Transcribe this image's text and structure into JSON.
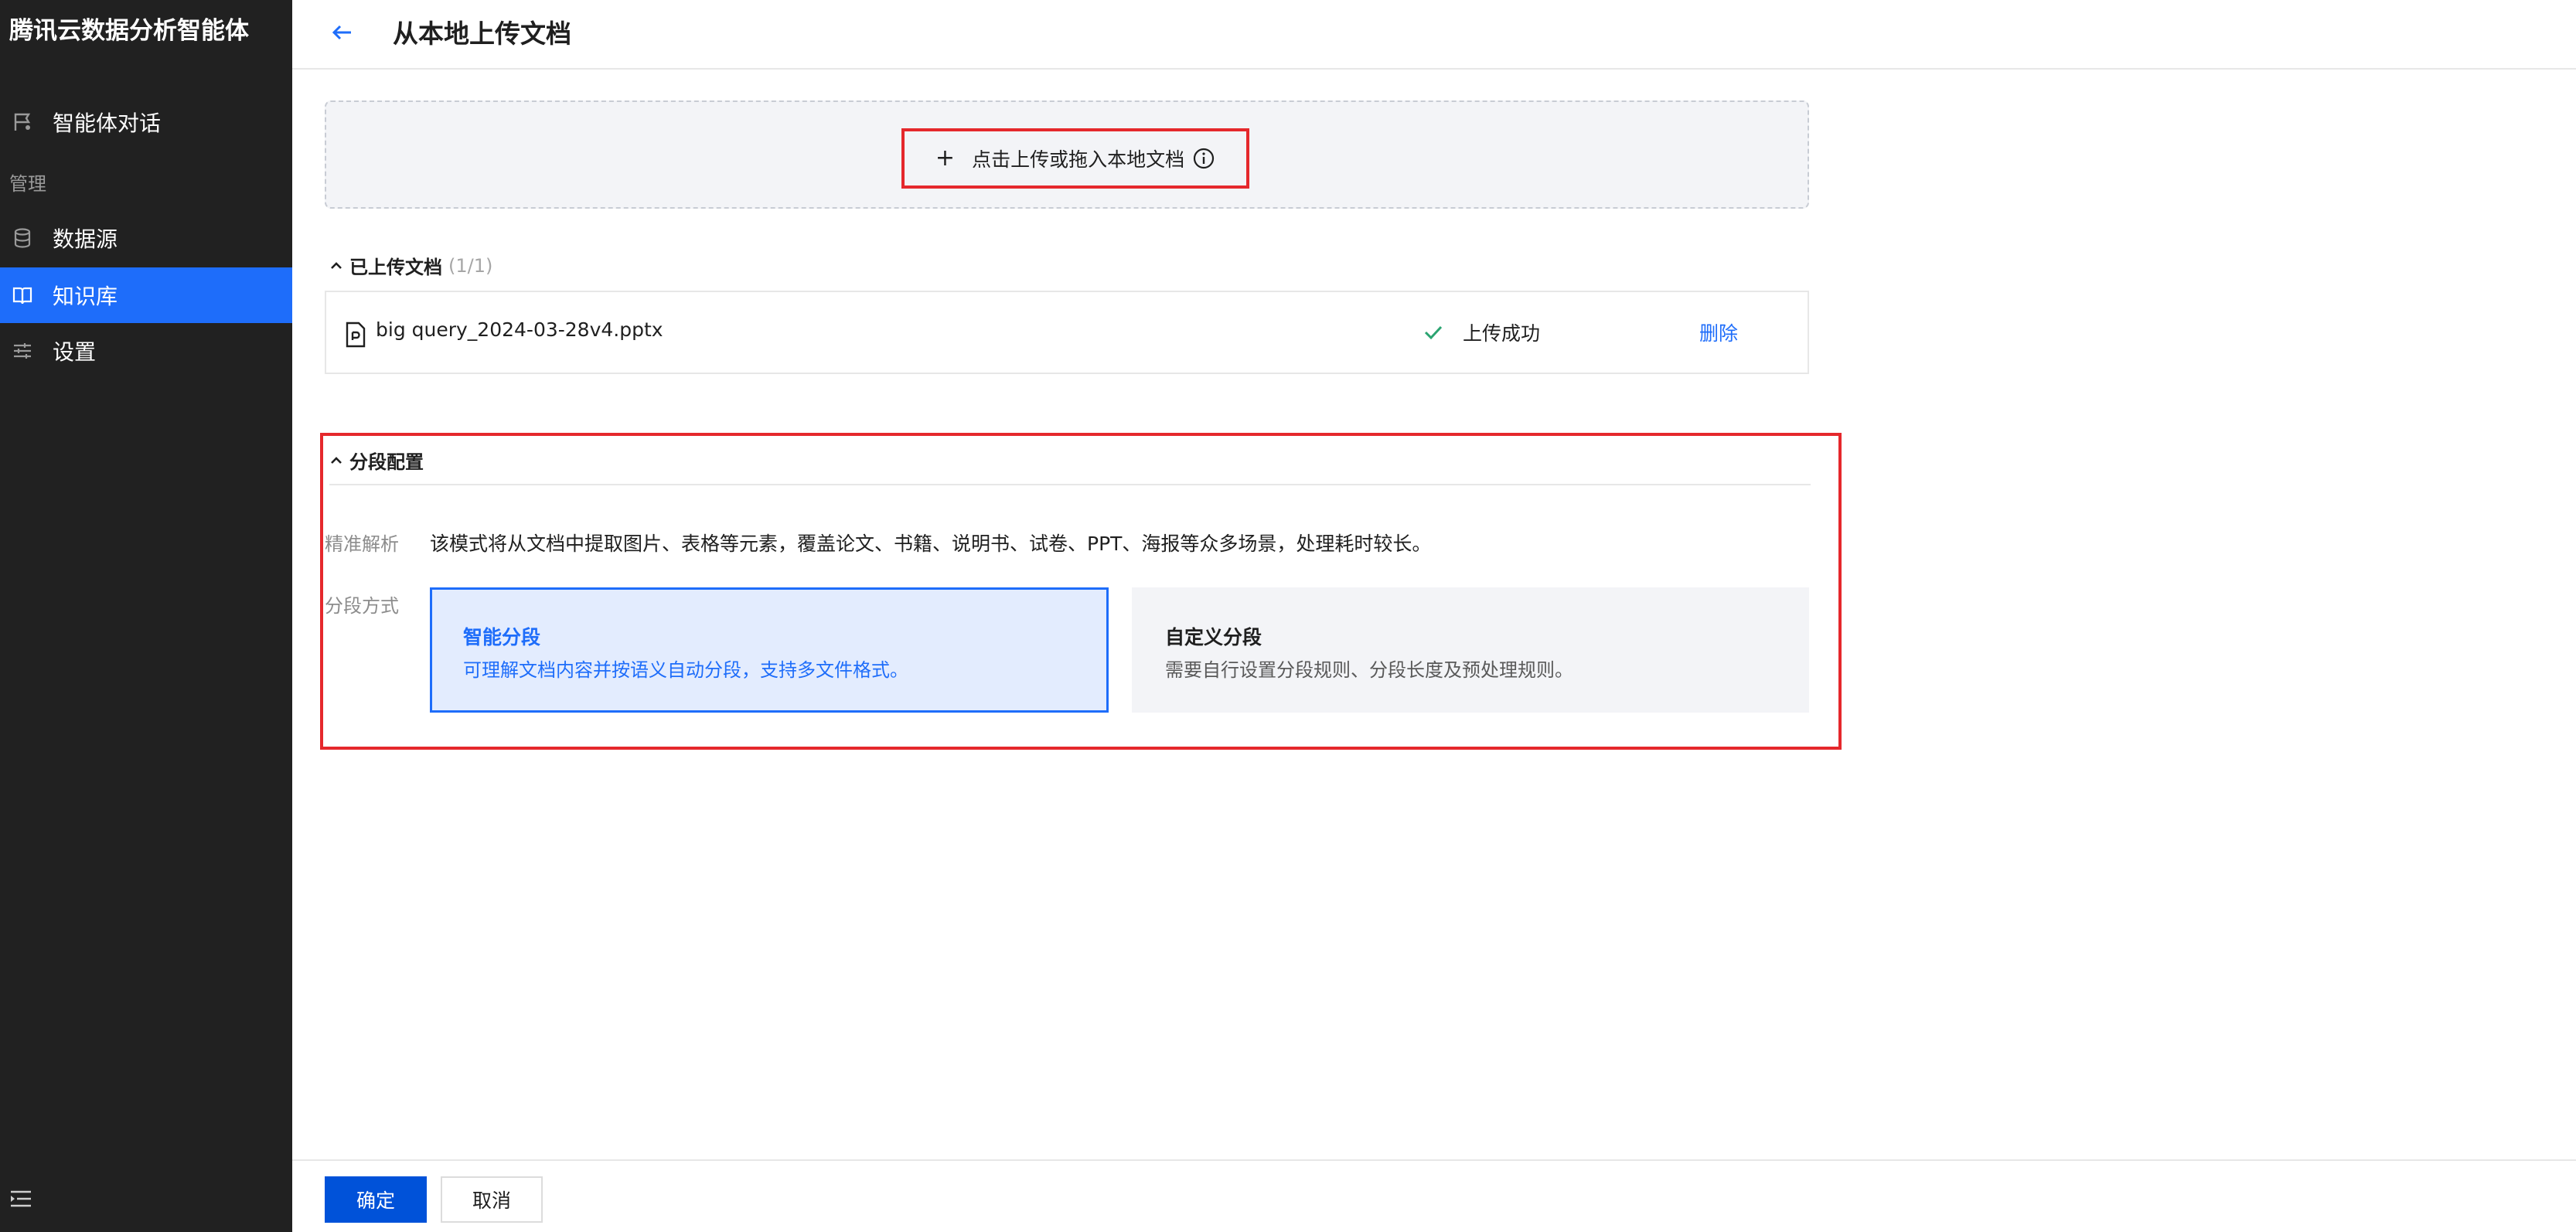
{
  "sidebar": {
    "brand": "腾讯云数据分析智能体",
    "chat_item": {
      "label": "智能体对话",
      "icon": "chat-flag-icon"
    },
    "group_label": "管理",
    "items": [
      {
        "label": "数据源",
        "icon": "database-icon"
      },
      {
        "label": "知识库",
        "icon": "book-icon",
        "active": true
      },
      {
        "label": "设置",
        "icon": "sliders-icon"
      }
    ],
    "collapse_icon": "menu-collapse-icon"
  },
  "header": {
    "back_icon": "arrow-left-icon",
    "title": "从本地上传文档"
  },
  "upload": {
    "plus": "+",
    "label": "点击上传或拖入本地文档",
    "info_icon": "info-circle-icon"
  },
  "uploaded": {
    "title": "已上传文档",
    "count": "(1/1)",
    "files": [
      {
        "name": "big query_2024-03-28v4.pptx",
        "status": "上传成功",
        "delete_label": "删除"
      }
    ]
  },
  "config": {
    "title": "分段配置",
    "parse_label": "精准解析",
    "parse_text": "该模式将从文档中提取图片、表格等元素，覆盖论文、书籍、说明书、试卷、PPT、海报等众多场景，处理耗时较长。",
    "method_label": "分段方式",
    "options": [
      {
        "title": "智能分段",
        "desc": "可理解文档内容并按语义自动分段，支持多文件格式。",
        "selected": true
      },
      {
        "title": "自定义分段",
        "desc": "需要自行设置分段规则、分段长度及预处理规则。",
        "selected": false
      }
    ]
  },
  "footer": {
    "confirm_label": "确定",
    "cancel_label": "取消"
  },
  "colors": {
    "sidebar_bg": "#212121",
    "accent": "#1e6dfa",
    "primary_button": "#0052d9",
    "highlight_border": "#e5282c",
    "success": "#2ba471"
  }
}
